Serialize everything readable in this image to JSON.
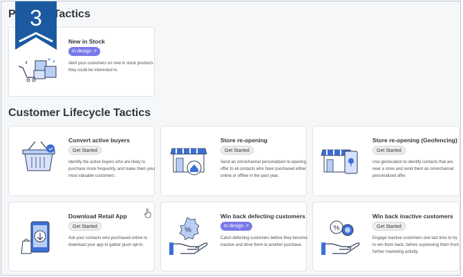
{
  "step_number": "3",
  "sections": {
    "product": {
      "title": "Product Tactics"
    },
    "lifecycle": {
      "title": "Customer Lifecycle Tactics"
    }
  },
  "cards": [
    {
      "id": "new-in-stock",
      "title": "New in Stock",
      "status": "In design",
      "status_type": "design",
      "description": "Alert your customers on new in stock products they could be interested in.",
      "icon": "boxes-cart-icon"
    },
    {
      "id": "convert-active-buyers",
      "title": "Convert active buyers",
      "status": "Get Started",
      "status_type": "started",
      "description": "Identify the active buyers who are likely to purchase more frequently, and make them your most valuable customers.",
      "icon": "shopping-basket-icon"
    },
    {
      "id": "store-reopening",
      "title": "Store re-opening",
      "status": "Get Started",
      "status_type": "started",
      "description": "Send an omnichannel personalized re-opening offer to all contacts who have purchased either online or offline in the past year.",
      "icon": "storefront-icon"
    },
    {
      "id": "store-reopening-geo",
      "title": "Store re-opening (Geofencing)",
      "status": "Get Started",
      "status_type": "started",
      "description": "Use geolocation to identify contacts that are near a store and send them an omnichannel personalized offer.",
      "icon": "storefront-phone-icon"
    },
    {
      "id": "download-retail-app",
      "title": "Download Retail App",
      "status": "Get Started",
      "status_type": "started",
      "description": "Ask your contacts who purchased online to download your app to gather push opt-in.",
      "icon": "phone-download-icon"
    },
    {
      "id": "win-back-defecting",
      "title": "Win back defecting customers",
      "status": "In design",
      "status_type": "design",
      "description": "Catch defecting customers before they become inactive and drive them to another purchase.",
      "icon": "hand-percent-icon"
    },
    {
      "id": "win-back-inactive",
      "title": "Win back inactive customers",
      "status": "Get Started",
      "status_type": "started",
      "description": "Engage inactive customers one last time to try to win them back, before supressing them from further marketing activity.",
      "icon": "hand-coins-icon"
    }
  ],
  "colors": {
    "accent": "#7a79e8",
    "brand_blue": "#1b5aa0",
    "icon_blue": "#3b6fd6",
    "icon_light": "#b9cdf5"
  }
}
